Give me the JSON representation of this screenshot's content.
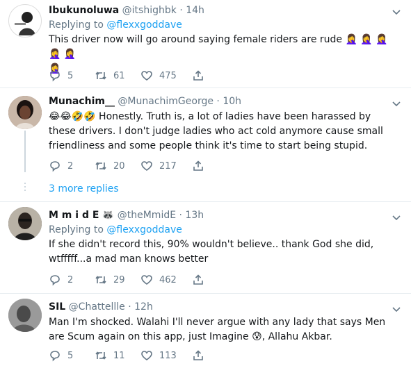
{
  "tweets": [
    {
      "name": "Ibukunoluwa",
      "handle": "@itshighbk",
      "time": "14h",
      "replying_prefix": "Replying to",
      "replying_to": "@flexxgoddave",
      "text": "This driver now will go around saying female riders are rude",
      "emojis": [
        "🤦‍♀️",
        "🤦‍♀️",
        "🤦‍♀️",
        "🤦‍♀️",
        "🤦‍♀️",
        "🤦‍♀️"
      ],
      "replies": "5",
      "retweets": "61",
      "likes": "475"
    },
    {
      "name": "Munachim__",
      "handle": "@MunachimGeorge",
      "time": "10h",
      "emojis": [
        "😂",
        "😂",
        "🤣",
        "🤣"
      ],
      "text": "Honestly. Truth is, a lot of ladies have been harassed by these drivers. I don't judge ladies who act cold anymore cause small friendliness and some people think it's time to start being stupid.",
      "replies": "2",
      "retweets": "20",
      "likes": "217"
    },
    {
      "name": "M m i d E",
      "name_emoji": "🦝",
      "handle": "@theMmidE",
      "time": "13h",
      "replying_prefix": "Replying to",
      "replying_to": "@flexxgoddave",
      "text": "If she didn't record this, 90% wouldn't believe.. thank God she did,  wtfffff...a mad man knows better",
      "replies": "2",
      "retweets": "29",
      "likes": "462"
    },
    {
      "name": "SIL",
      "handle": "@Chattellle",
      "time": "12h",
      "text_before": "Man I'm shocked. Walahi I'll never argue with any lady that says Men are Scum again on this app, just Imagine",
      "emoji": "😰",
      "text_after": ", Allahu Akbar.",
      "replies": "5",
      "retweets": "11",
      "likes": "113"
    }
  ],
  "more_replies": "3 more replies",
  "colors": {
    "link": "#1da1f2",
    "muted": "#657786",
    "divider": "#e6ecf0"
  }
}
